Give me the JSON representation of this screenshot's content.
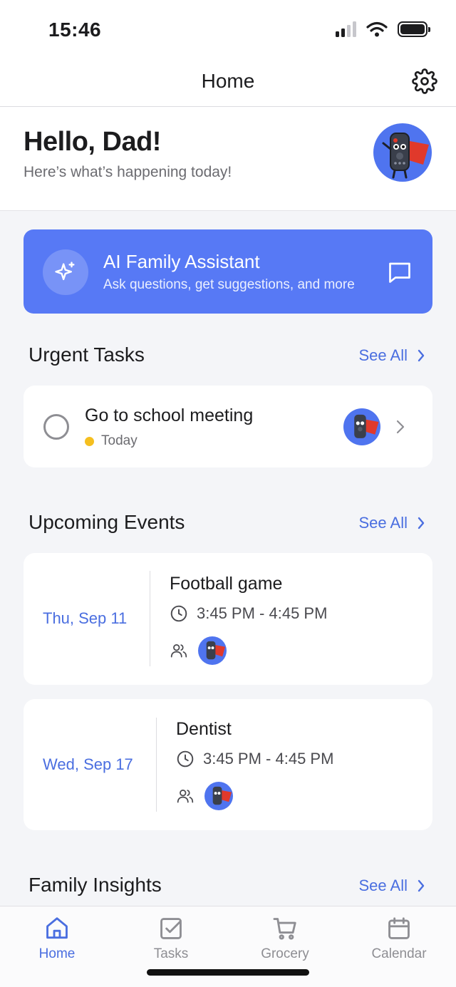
{
  "status_bar": {
    "time": "15:46"
  },
  "nav": {
    "title": "Home"
  },
  "greeting": {
    "title": "Hello, Dad!",
    "subtitle": "Here’s what’s happening today!"
  },
  "ai_assistant": {
    "title": "AI Family Assistant",
    "subtitle": "Ask questions, get suggestions, and more"
  },
  "urgent_tasks": {
    "title": "Urgent Tasks",
    "see_all": "See All",
    "items": [
      {
        "title": "Go to school meeting",
        "due": "Today",
        "due_color": "#f5bf1f"
      }
    ]
  },
  "upcoming_events": {
    "title": "Upcoming Events",
    "see_all": "See All",
    "items": [
      {
        "date": "Thu, Sep 11",
        "title": "Football game",
        "time": "3:45 PM - 4:45 PM"
      },
      {
        "date": "Wed, Sep 17",
        "title": "Dentist",
        "time": "3:45 PM - 4:45 PM"
      }
    ]
  },
  "family_insights": {
    "title": "Family Insights",
    "see_all": "See All"
  },
  "tab_bar": {
    "active": "Home",
    "tabs": [
      {
        "label": "Home",
        "icon": "home-icon"
      },
      {
        "label": "Tasks",
        "icon": "checkbox-icon"
      },
      {
        "label": "Grocery",
        "icon": "cart-icon"
      },
      {
        "label": "Calendar",
        "icon": "calendar-icon"
      }
    ]
  },
  "colors": {
    "accent": "#4a6ee0",
    "assistant_card": "#5779f5",
    "avatar_bg": "#4f74ef",
    "background": "#f4f5f8"
  }
}
